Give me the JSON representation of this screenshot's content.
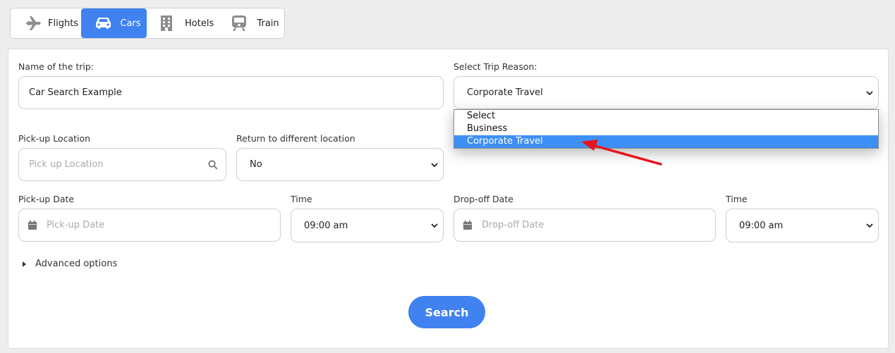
{
  "tabs": [
    {
      "label": "Flights",
      "icon": "plane-icon"
    },
    {
      "label": "Cars",
      "icon": "car-icon",
      "active": true
    },
    {
      "label": "Hotels",
      "icon": "building-icon"
    },
    {
      "label": "Train",
      "icon": "train-icon"
    }
  ],
  "form": {
    "trip_name_label": "Name of the trip:",
    "trip_name_value": "Car Search Example",
    "trip_reason_label": "Select Trip Reason:",
    "trip_reason_value": "Corporate Travel",
    "trip_reason_options": [
      "Select",
      "Business",
      "Corporate Travel"
    ],
    "pickup_location_label": "Pick-up Location",
    "pickup_location_placeholder": "Pick up Location",
    "return_label": "Return to different location",
    "return_value": "No",
    "pickup_date_label": "Pick-up Date",
    "pickup_date_placeholder": "Pick-up Date",
    "pickup_time_label": "Time",
    "pickup_time_value": "09:00 am",
    "dropoff_date_label": "Drop-off Date",
    "dropoff_date_placeholder": "Drop-off Date",
    "dropoff_time_label": "Time",
    "dropoff_time_value": "09:00 am",
    "advanced_label": "Advanced options",
    "search_label": "Search"
  },
  "colors": {
    "accent": "#3f82f0",
    "selected_option": "#3e8ff5",
    "annotation_arrow": "#e8141b"
  }
}
